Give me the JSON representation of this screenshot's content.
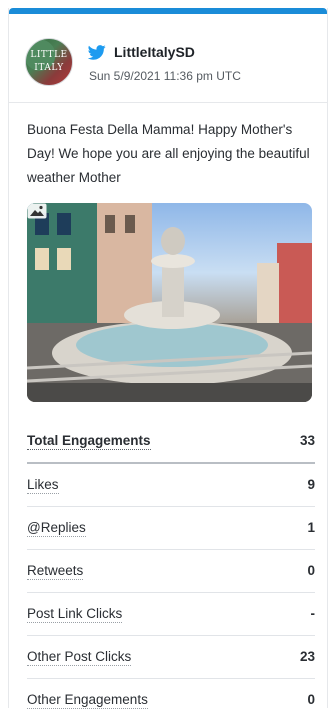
{
  "colors": {
    "accent": "#1a8cd8",
    "twitter": "#1d9bf0"
  },
  "header": {
    "avatar_text_1": "LITTLE",
    "avatar_text_2": "ITALY",
    "handle": "LittleItalySD",
    "timestamp": "Sun 5/9/2021 11:36 pm UTC",
    "network_icon": "twitter-bird-icon"
  },
  "post": {
    "text": "Buona Festa Della Mamma! Happy Mother's Day! We hope you are all enjoying the beautiful weather Mother",
    "media_icon": "image-icon"
  },
  "metrics": {
    "total": {
      "label": "Total Engagements",
      "value": "33"
    },
    "rows": [
      {
        "label": "Likes",
        "value": "9"
      },
      {
        "label": "@Replies",
        "value": "1"
      },
      {
        "label": "Retweets",
        "value": "0"
      },
      {
        "label": "Post Link Clicks",
        "value": "-"
      },
      {
        "label": "Other Post Clicks",
        "value": "23"
      },
      {
        "label": "Other Engagements",
        "value": "0"
      }
    ]
  }
}
